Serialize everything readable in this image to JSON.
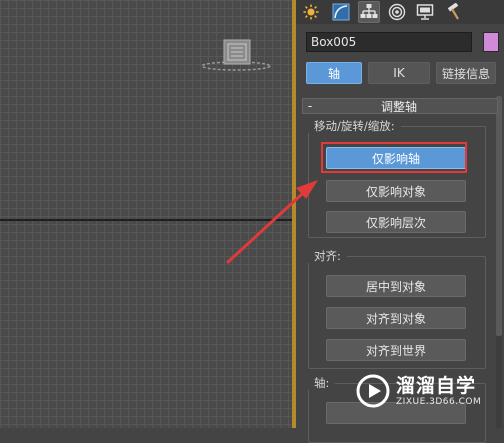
{
  "command_panel": {
    "tabs": [
      {
        "icon": "create-icon",
        "active": false
      },
      {
        "icon": "modify-icon",
        "active": false
      },
      {
        "icon": "hierarchy-icon",
        "active": true
      },
      {
        "icon": "motion-icon",
        "active": false
      },
      {
        "icon": "display-icon",
        "active": false
      },
      {
        "icon": "utilities-icon",
        "active": false
      }
    ],
    "object_name": "Box005",
    "object_color": "#d08ad8",
    "hierarchy_modes": {
      "pivot": "轴",
      "ik": "IK",
      "link_info": "链接信息"
    },
    "rollout": {
      "toggle": "-",
      "title": "调整轴"
    },
    "move_rotate_scale": {
      "label": "移动/旋转/缩放:",
      "buttons": [
        "仅影响轴",
        "仅影响对象",
        "仅影响层次"
      ]
    },
    "alignment": {
      "label": "对齐:",
      "buttons": [
        "居中到对象",
        "对齐到对象",
        "对齐到世界"
      ]
    },
    "pivot_group": {
      "label": "轴:"
    }
  },
  "colors": {
    "active_blue": "#5b98d8",
    "highlight_red": "#e03a3a",
    "viewport_border": "#b48a2a"
  },
  "watermark": {
    "title": "溜溜自学",
    "subtitle": "ZIXUE.3D66.COM"
  }
}
